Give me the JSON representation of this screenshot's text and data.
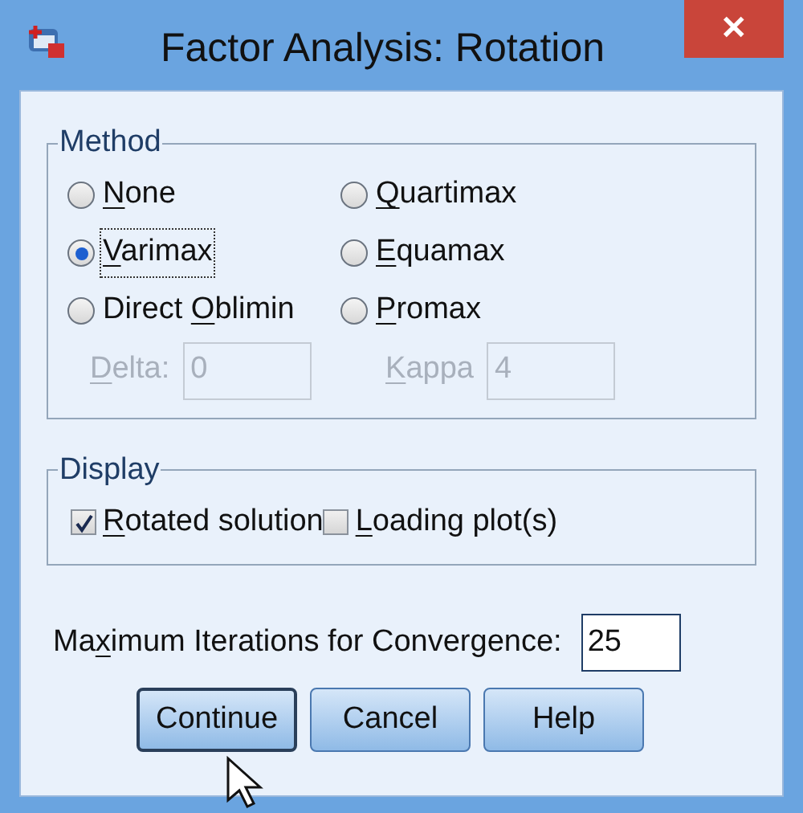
{
  "window": {
    "title": "Factor Analysis: Rotation",
    "close": "✕"
  },
  "method": {
    "title": "Method",
    "options": [
      {
        "key": "N",
        "post": "one",
        "selected": false
      },
      {
        "key": "Q",
        "post": "uartimax",
        "selected": false
      },
      {
        "key": "V",
        "post": "arimax",
        "selected": true
      },
      {
        "key": "E",
        "post": "quamax",
        "selected": false
      },
      {
        "pre": "Direct ",
        "key": "O",
        "post": "blimin",
        "selected": false
      },
      {
        "key": "P",
        "post": "romax",
        "selected": false
      }
    ],
    "params": [
      {
        "key": "D",
        "post": "elta:",
        "value": "0",
        "disabled": true
      },
      {
        "key": "K",
        "post": "appa",
        "value": "4",
        "disabled": true
      }
    ]
  },
  "display": {
    "title": "Display",
    "options": [
      {
        "key": "R",
        "post": "otated solution",
        "checked": true
      },
      {
        "key": "L",
        "post": "oading plot(s)",
        "checked": false
      }
    ]
  },
  "iterations": {
    "pre": "Ma",
    "key": "x",
    "post": "imum Iterations for Convergence:",
    "value": "25"
  },
  "buttons": [
    {
      "label": "Continue",
      "focused": true
    },
    {
      "label": "Cancel",
      "focused": false
    },
    {
      "label": "Help",
      "focused": false
    }
  ]
}
